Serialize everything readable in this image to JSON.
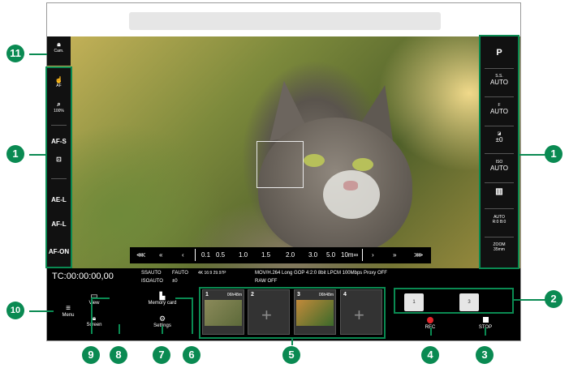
{
  "left_panel": {
    "cam_label": "Cam.",
    "af_label": "AF",
    "zoom_label": "100%",
    "afs_label": "AF-S",
    "ael_label": "AE-L",
    "afl_label": "AF-L",
    "afon_label": "AF-ON"
  },
  "right_panel": {
    "mode": "P",
    "ss_label": "S.S.",
    "ss_value": "AUTO",
    "f_label": "F",
    "f_value": "AUTO",
    "ev_value": "±0",
    "iso_label": "ISO",
    "iso_value": "AUTO",
    "wb_value": "AUTO",
    "wb_sub": "R:0 B:0",
    "zoom_label": "ZOOM",
    "zoom_value": "35mm"
  },
  "scrubber": {
    "speeds": [
      "0.1",
      "0.5",
      "1.0",
      "1.5",
      "2.0",
      "3.0",
      "5.0",
      "10m∞"
    ]
  },
  "status": {
    "timecode": "TC:00:00:00,00",
    "ss_auto": "SSAUTO",
    "f_auto": "FAUTO",
    "iso_auto": "ISOAUTO",
    "ev": "±0",
    "format": "MOV/H.264 Long GOP 4:2:0 8bit LPCM 100Mbps Proxy OFF",
    "raw": "RAW OFF",
    "res": "4K 16:9 29.97P"
  },
  "bottom": {
    "menu_label": "Menu",
    "view_label": "View",
    "screen_label": "Screen",
    "memory_label": "Memory card",
    "settings_label": "Settings",
    "rec_label": "REC",
    "stop_label": "STOP",
    "preset_1": "1",
    "preset_3": "3",
    "slots": [
      {
        "num": "1",
        "rem": "06h48m"
      },
      {
        "num": "2",
        "rem": ""
      },
      {
        "num": "3",
        "rem": "06h48m"
      },
      {
        "num": "4",
        "rem": ""
      }
    ]
  },
  "callouts": {
    "c1": "1",
    "c2": "2",
    "c3": "3",
    "c4": "4",
    "c5": "5",
    "c6": "6",
    "c7": "7",
    "c8": "8",
    "c9": "9",
    "c10": "10",
    "c11": "11"
  },
  "colors": {
    "callout_green": "#0a8a52",
    "rec_red": "#e3262b"
  }
}
